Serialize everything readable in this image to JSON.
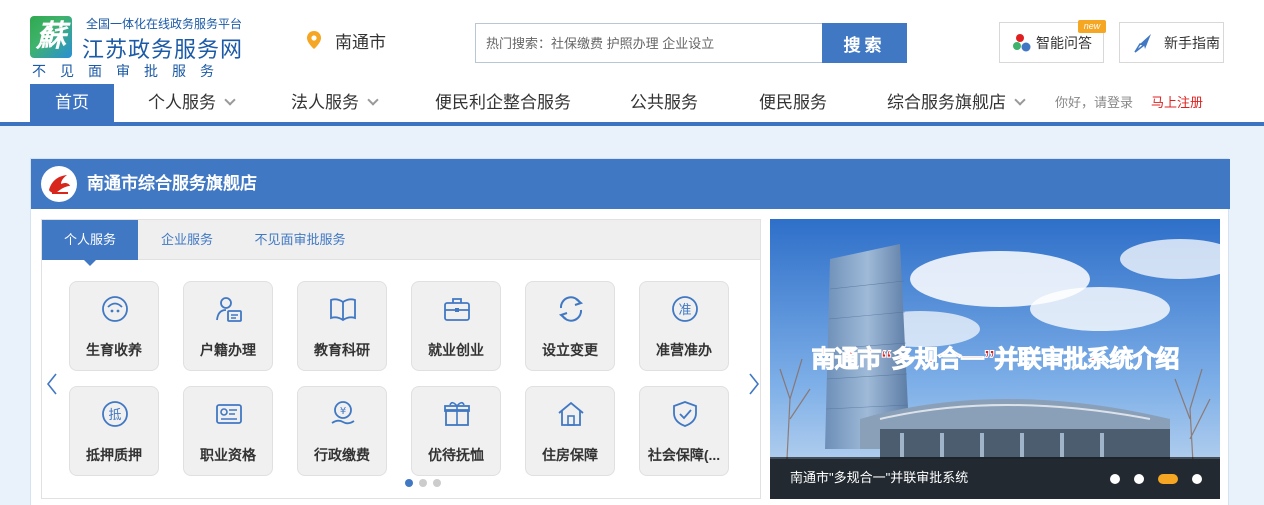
{
  "header": {
    "logo_glyph": "蘇",
    "platform": "全国一体化在线政务服务平台",
    "site_title": "江苏政务服务网",
    "slogan": "不见面审批服务",
    "city": "南通市",
    "search_placeholder": "热门搜索：社保缴费 护照办理 企业设立",
    "search_button": "搜索",
    "ai_button": "智能问答",
    "new_badge": "new",
    "guide_button": "新手指南"
  },
  "nav": {
    "items": [
      {
        "label": "首页",
        "active": true
      },
      {
        "label": "个人服务",
        "dropdown": true
      },
      {
        "label": "法人服务",
        "dropdown": true
      },
      {
        "label": "便民利企整合服务"
      },
      {
        "label": "公共服务"
      },
      {
        "label": "便民服务"
      },
      {
        "label": "综合服务旗舰店",
        "dropdown": true
      }
    ],
    "login_hint": "你好，请登录",
    "register": "马上注册"
  },
  "panel": {
    "title": "南通市综合服务旗舰店",
    "tabs": [
      "个人服务",
      "企业服务",
      "不见面审批服务"
    ],
    "services": [
      {
        "label": "生育收养",
        "icon": "baby-icon"
      },
      {
        "label": "户籍办理",
        "icon": "household-icon"
      },
      {
        "label": "教育科研",
        "icon": "book-icon"
      },
      {
        "label": "就业创业",
        "icon": "briefcase-icon"
      },
      {
        "label": "设立变更",
        "icon": "refresh-icon"
      },
      {
        "label": "准营准办",
        "icon": "approve-icon"
      },
      {
        "label": "抵押质押",
        "icon": "mortgage-icon"
      },
      {
        "label": "职业资格",
        "icon": "certificate-icon"
      },
      {
        "label": "行政缴费",
        "icon": "payment-icon"
      },
      {
        "label": "优待抚恤",
        "icon": "gift-icon"
      },
      {
        "label": "住房保障",
        "icon": "house-icon"
      },
      {
        "label": "社会保障(...",
        "icon": "shield-icon"
      }
    ],
    "pager_dots": 3,
    "pager_active": 0
  },
  "banner": {
    "headline": "南通市“多规合一”并联审批系统介绍",
    "caption": "南通市\"多规合一\"并联审批系统",
    "dots": 4,
    "active_dot": 2
  },
  "colors": {
    "primary": "#4178c4",
    "title_blue": "#1b5aa6",
    "register_red": "#e02020",
    "badge_orange": "#f5a623",
    "page_bg": "#e9f1fb"
  }
}
